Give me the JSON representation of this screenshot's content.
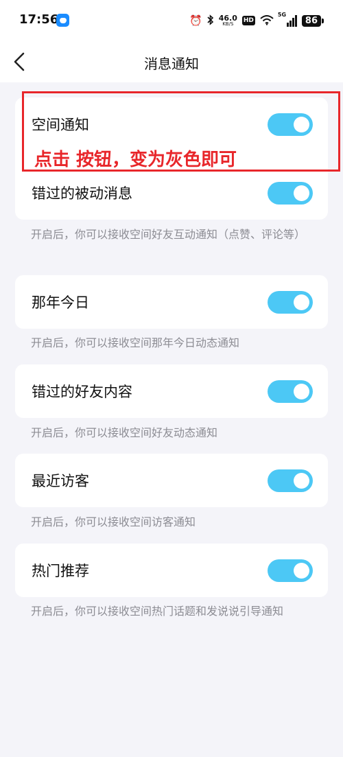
{
  "status_bar": {
    "time": "17:56",
    "net_speed_value": "46.0",
    "net_speed_unit": "KB/S",
    "hd_label": "HD",
    "signal_label": "5G",
    "battery": "86",
    "icons": [
      "alarm-icon",
      "bluetooth-icon",
      "wifi-icon",
      "signal-icon",
      "battery-icon"
    ]
  },
  "header": {
    "title": "消息通知"
  },
  "settings": [
    {
      "label": "空间通知",
      "enabled": true,
      "description": ""
    },
    {
      "label": "错过的被动消息",
      "enabled": true,
      "description": "开启后，你可以接收空间好友互动通知（点赞、评论等）"
    },
    {
      "label": "那年今日",
      "enabled": true,
      "description": "开启后，你可以接收空间那年今日动态通知"
    },
    {
      "label": "错过的好友内容",
      "enabled": true,
      "description": "开启后，你可以接收空间好友动态通知"
    },
    {
      "label": "最近访客",
      "enabled": true,
      "description": "开启后，你可以接收空间访客通知"
    },
    {
      "label": "热门推荐",
      "enabled": true,
      "description": "开启后，你可以接收空间热门话题和发说说引导通知"
    }
  ],
  "annotation": {
    "text": "点击 按钮，变为灰色即可",
    "color": "#e8262a"
  },
  "colors": {
    "toggle_on": "#4cc8f5",
    "background": "#f4f4f9",
    "description_text": "#8c8c93"
  }
}
